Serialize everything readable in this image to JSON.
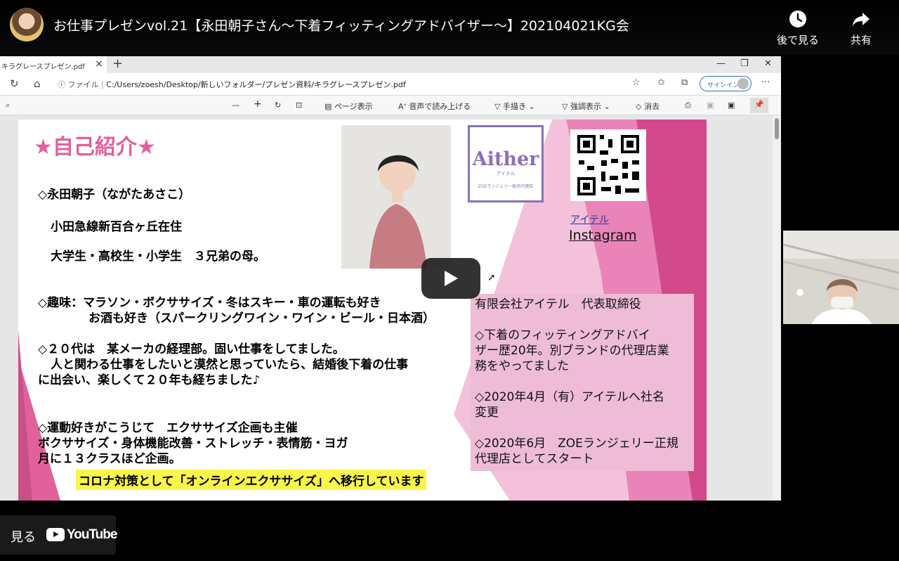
{
  "video": {
    "title": "お仕事プレゼンvol.21【永田朝子さん〜下着フィッティングアドバイザー〜】202104021KG会",
    "watch_later_label": "後で見る",
    "share_label": "共有",
    "watch_label": "見る",
    "youtube_label": "YouTube"
  },
  "browser": {
    "tab_title": "キラグレースプレゼン.pdf",
    "address_prefix": "ファイル",
    "address": "C:/Users/zoesh/Desktop/新しいフォルダー/プレゼン資料/キラグレースプレゼン.pdf",
    "signin_label": "サインイン",
    "pdf_toolbar": {
      "minus": "—",
      "plus": "+",
      "page_view": "ページ表示",
      "read_aloud": "音声で読み上げる",
      "draw": "手描き",
      "highlight": "強調表示",
      "erase": "消去"
    }
  },
  "slide": {
    "title": "★自己紹介★",
    "lines": [
      "◇永田朝子（ながたあさこ）",
      "小田急線新百合ヶ丘在住",
      "大学生・高校生・小学生　３兄弟の母。",
      "◇趣味：マラソン・ボクササイズ・冬はスキー・車の運転も好き",
      "お酒も好き（スパークリングワイン・ワイン・ビール・日本酒）",
      "◇２０代は　某メーカの経理部。固い仕事をしてました。",
      "人と関わる仕事をしたいと漠然と思っていたら、結婚後下着の仕事",
      "に出会い、楽しくて２０年も経ちました♪",
      "◇運動好きがこうじて　エクササイズ企画も主催",
      "ボクササイズ・身体機能改善・ストレッチ・表情筋・ヨガ",
      "月に１３クラスほど企画。"
    ],
    "highlight": "コロナ対策として「オンラインエクササイズ」へ移行しています",
    "logo": {
      "name": "Aither",
      "sub": "アイテル",
      "tag": "ZOEランジェリー販売代理店"
    },
    "link_aiteru": "アイテル",
    "link_instagram": "Instagram",
    "info": [
      "有限会社アイテル　代表取締役",
      "",
      "◇下着のフィッティングアドバイ",
      "ザー歴20年。別ブランドの代理店業",
      "務をやってました",
      "",
      "◇2020年4月（有）アイテルへ社名",
      "変更",
      "",
      "◇2020年6月　ZOEランジェリー正規",
      "代理店としてスタート"
    ]
  },
  "colors": {
    "accent_pink": "#e2609c",
    "box_pink": "#eebcd6",
    "logo_purple": "#8a71b8",
    "highlight_yellow": "#f9f54a"
  }
}
